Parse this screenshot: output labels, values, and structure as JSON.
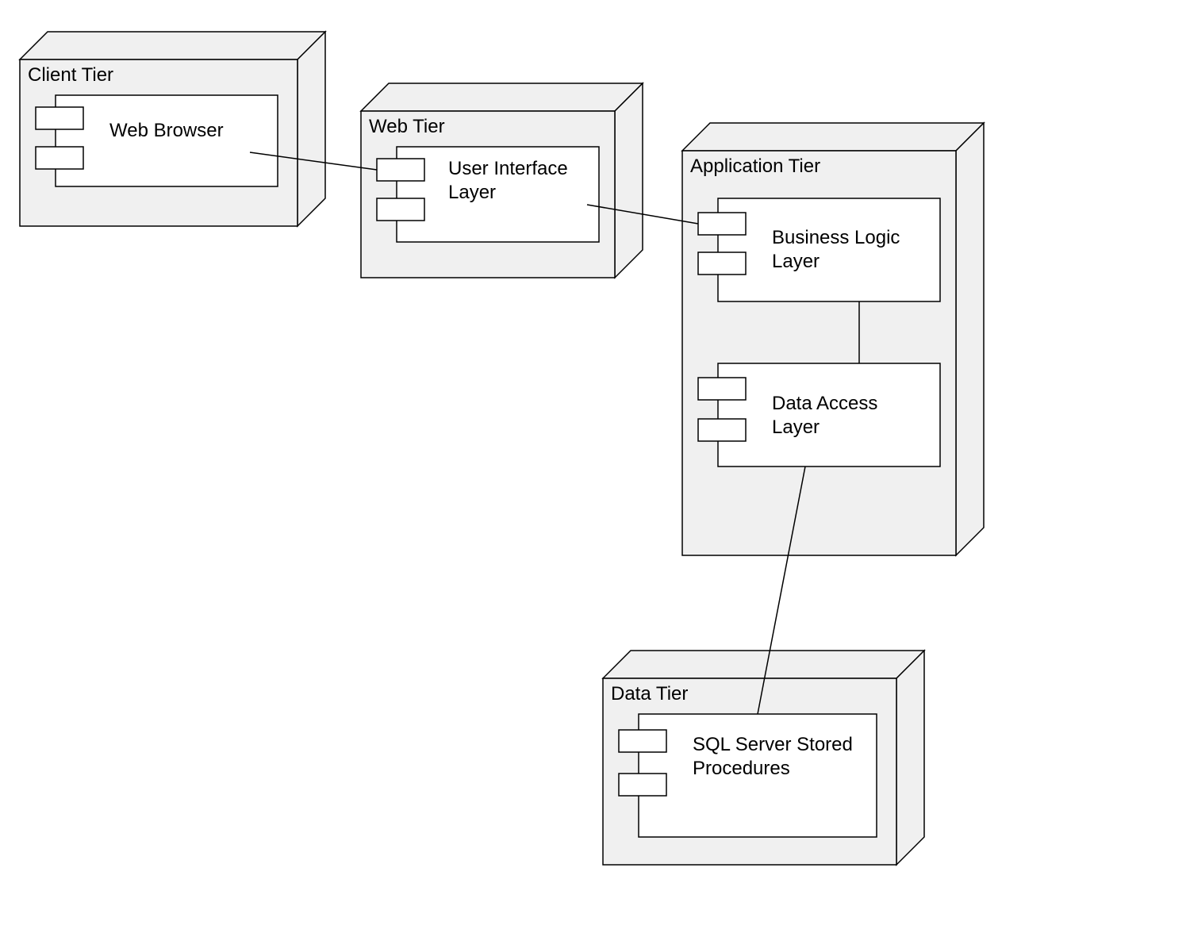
{
  "nodes": {
    "client": {
      "label": "Client Tier"
    },
    "web": {
      "label": "Web Tier"
    },
    "application": {
      "label": "Application Tier"
    },
    "data": {
      "label": "Data Tier"
    }
  },
  "components": {
    "web_browser": {
      "label": "Web Browser"
    },
    "user_interface_layer": {
      "label": "User Interface Layer"
    },
    "business_logic_layer": {
      "label": "Business Logic Layer"
    },
    "data_access_layer": {
      "label": "Data Access Layer"
    },
    "sql_server_stored_procs": {
      "label": "SQL Server Stored Procedures"
    }
  },
  "edges": [
    {
      "from": "web_browser",
      "to": "user_interface_layer"
    },
    {
      "from": "user_interface_layer",
      "to": "business_logic_layer"
    },
    {
      "from": "business_logic_layer",
      "to": "data_access_layer"
    },
    {
      "from": "data_access_layer",
      "to": "sql_server_stored_procs"
    }
  ]
}
